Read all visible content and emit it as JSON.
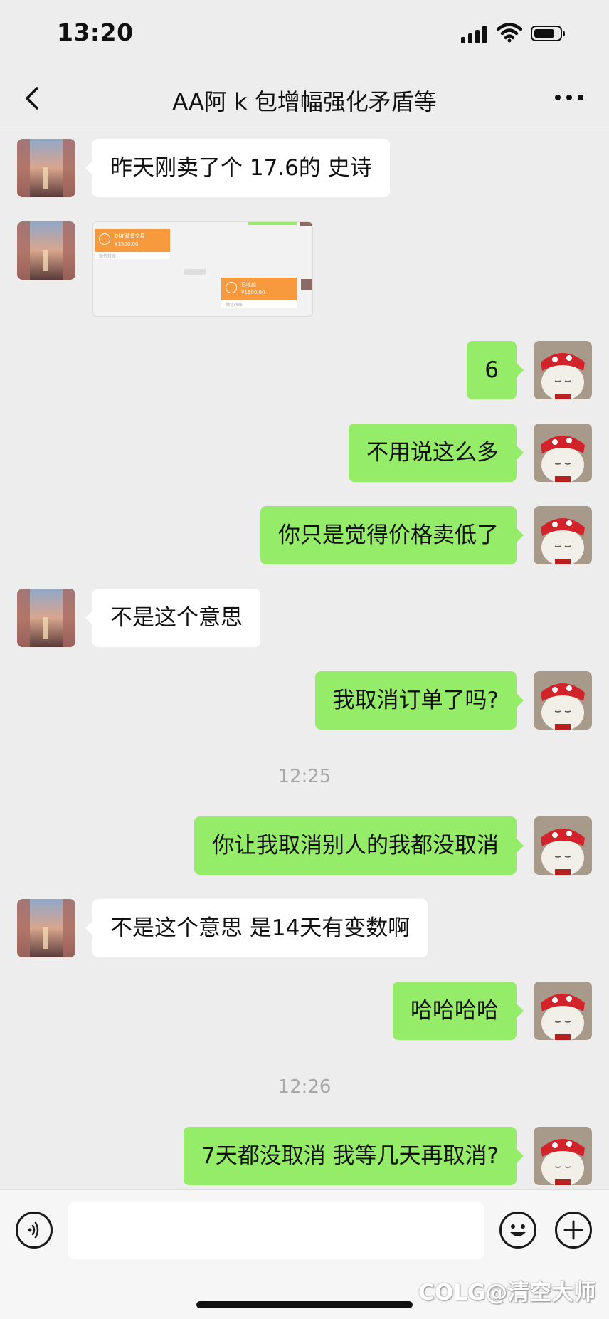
{
  "status_bar": {
    "time": "13:20"
  },
  "header": {
    "back_icon": "chevron-left-icon",
    "title": "AA阿 k 包增幅强化矛盾等",
    "more_icon": "more-dots-icon"
  },
  "messages": [
    {
      "type": "text",
      "side": "in",
      "text": "昨天刚卖了个 17.6的 史诗"
    },
    {
      "type": "image",
      "side": "in",
      "card1": {
        "line1": "DNF装备交易",
        "line2": "¥1500.00",
        "line3": "微信转账"
      },
      "card2": {
        "line1": "已收款",
        "line2": "¥1500.00",
        "line3": "微信转账"
      }
    },
    {
      "type": "text",
      "side": "out",
      "text": "6"
    },
    {
      "type": "text",
      "side": "out",
      "text": "不用说这么多"
    },
    {
      "type": "text",
      "side": "out",
      "text": "你只是觉得价格卖低了"
    },
    {
      "type": "text",
      "side": "in",
      "text": "不是这个意思"
    },
    {
      "type": "text",
      "side": "out",
      "text": "我取消订单了吗?"
    },
    {
      "type": "time",
      "text": "12:25"
    },
    {
      "type": "text",
      "side": "out",
      "text": "你让我取消别人的我都没取消"
    },
    {
      "type": "text",
      "side": "in",
      "text": "不是这个意思 是14天有变数啊"
    },
    {
      "type": "text",
      "side": "out",
      "text": "哈哈哈哈"
    },
    {
      "type": "time",
      "text": "12:26"
    },
    {
      "type": "text",
      "side": "out",
      "text": "7天都没取消 我等几天再取消?"
    }
  ],
  "input_bar": {
    "voice_icon": "voice-icon",
    "emoji_icon": "emoji-icon",
    "plus_icon": "plus-icon",
    "input_value": ""
  },
  "watermark": "COLG@清空大师",
  "colors": {
    "outgoing_bubble": "#95ec69",
    "incoming_bubble": "#ffffff",
    "background": "#ededed"
  }
}
